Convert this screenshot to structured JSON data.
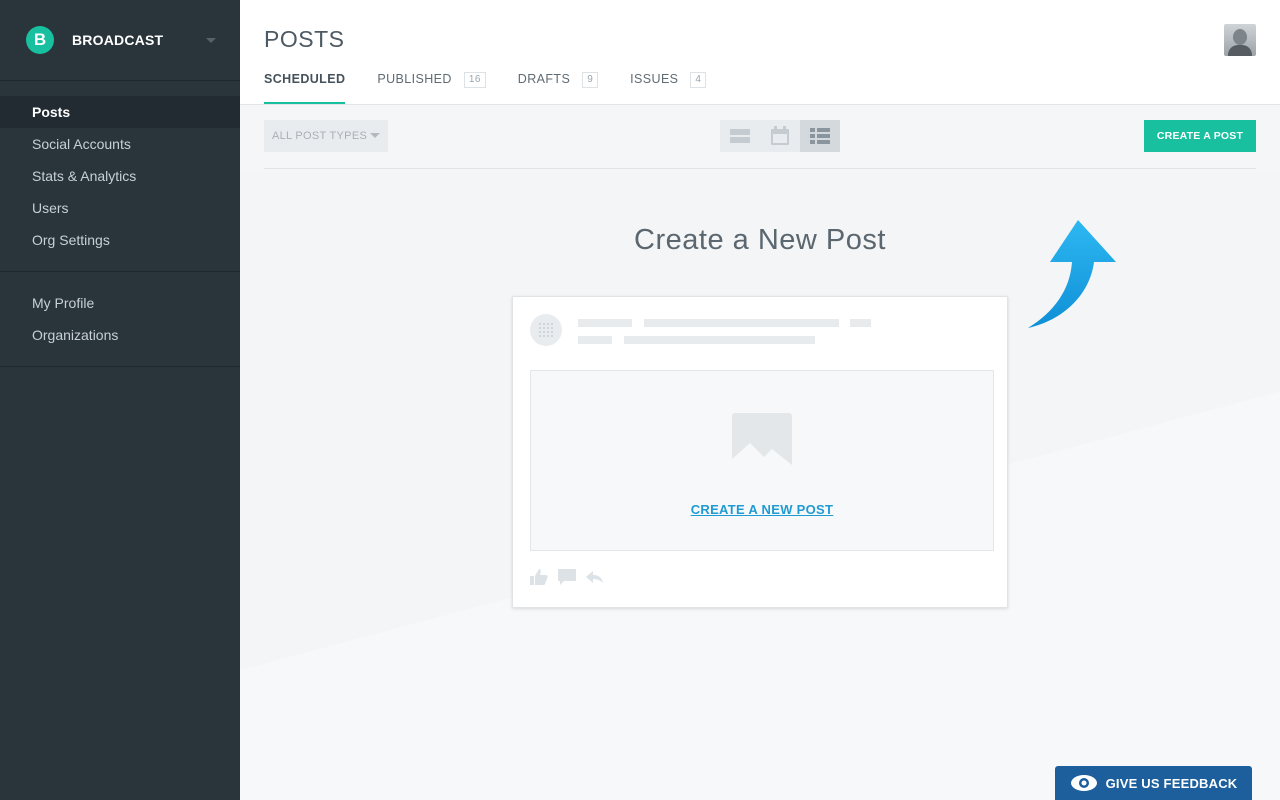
{
  "brand": {
    "name": "BROADCAST",
    "logo_letter": "B",
    "accent": "#19c0a0"
  },
  "sidebar": {
    "primary": [
      {
        "label": "Posts",
        "active": true
      },
      {
        "label": "Social Accounts"
      },
      {
        "label": "Stats & Analytics"
      },
      {
        "label": "Users"
      },
      {
        "label": "Org Settings"
      }
    ],
    "secondary": [
      {
        "label": "My Profile"
      },
      {
        "label": "Organizations"
      }
    ]
  },
  "header": {
    "title": "POSTS",
    "tabs": [
      {
        "label": "SCHEDULED",
        "count": "",
        "active": true
      },
      {
        "label": "PUBLISHED",
        "count": "16"
      },
      {
        "label": "DRAFTS",
        "count": "9"
      },
      {
        "label": "ISSUES",
        "count": "4"
      }
    ]
  },
  "toolbar": {
    "post_type_filter": "ALL POST TYPES",
    "views": [
      "list-view-icon",
      "calendar-view-icon",
      "grid-view-icon"
    ],
    "active_view": "grid-view-icon",
    "create_label": "CREATE A POST"
  },
  "empty_state": {
    "title": "Create a New Post",
    "link_label": "CREATE A NEW POST",
    "arrow_color": "#18a7e8"
  },
  "feedback": {
    "label": "GIVE US FEEDBACK",
    "color": "#1c5f9c"
  }
}
